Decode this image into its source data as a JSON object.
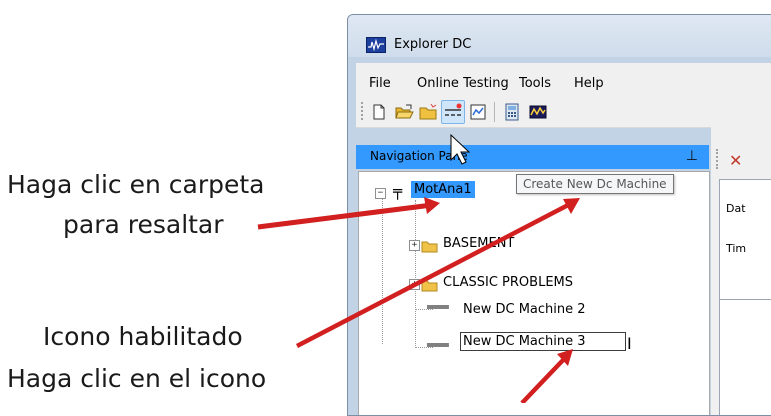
{
  "annotations": {
    "line1": "Haga clic en carpeta",
    "line2": "para resaltar",
    "line3": "Icono habilitado",
    "line4": "Haga clic en el icono"
  },
  "window": {
    "title": "Explorer DC",
    "menu": [
      "File",
      "Online Testing",
      "Tools",
      "Help"
    ]
  },
  "toolbar": {
    "icons": [
      "new-file-icon",
      "open-folder-icon",
      "folder-icon",
      "new-dc-machine-icon",
      "report-icon",
      "calculator-icon",
      "chart-icon"
    ],
    "tooltip": "Create New Dc Machine"
  },
  "navigation": {
    "title": "Navigation Pane",
    "pin_icon": "pin-icon",
    "tree": {
      "root": "MotAna1",
      "items": [
        "BASEMENT",
        "CLASSIC PROBLEMS",
        "New DC Machine 2"
      ],
      "editing": "New DC Machine 3"
    }
  },
  "right_panel": {
    "labels": [
      "Dat",
      "Tim"
    ]
  },
  "colors": {
    "annotation_arrow": "#d21f1f",
    "selection": "#3399ff",
    "nav_header": "#3399ff"
  }
}
